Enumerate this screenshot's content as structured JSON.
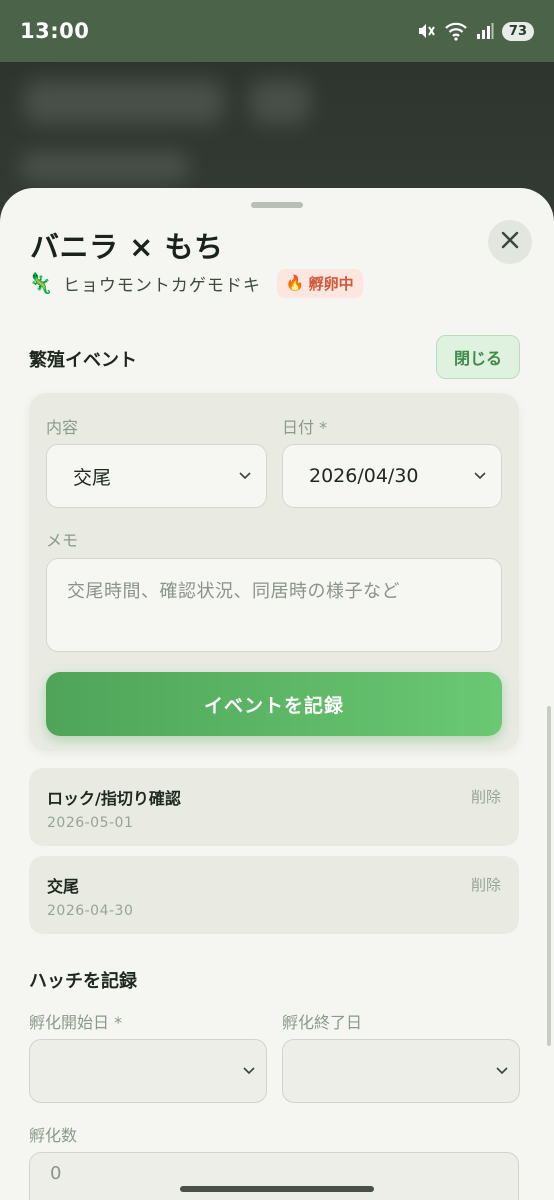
{
  "status_bar": {
    "time": "13:00",
    "battery": "73",
    "icons": [
      "mute-icon",
      "wifi-icon",
      "signal-icon"
    ]
  },
  "sheet": {
    "title": "バニラ × もち",
    "species_icon": "🦎",
    "species": "ヒョウモントカゲモドキ",
    "status_icon": "🔥",
    "status": "孵卵中",
    "close_icon": "close-icon"
  },
  "breeding_events": {
    "section_title": "繁殖イベント",
    "toggle_label": "閉じる",
    "form": {
      "content_label": "内容",
      "content_value": "交尾",
      "date_label": "日付 *",
      "date_value": "2026/04/30",
      "memo_label": "メモ",
      "memo_placeholder": "交尾時間、確認状況、同居時の様子など",
      "submit_label": "イベントを記録"
    },
    "events": [
      {
        "title": "ロック/指切り確認",
        "date": "2026-05-01",
        "delete_label": "削除"
      },
      {
        "title": "交尾",
        "date": "2026-04-30",
        "delete_label": "削除"
      }
    ]
  },
  "hatch": {
    "section_title": "ハッチを記録",
    "start_label": "孵化開始日 *",
    "end_label": "孵化終了日",
    "count_label": "孵化数",
    "count_value": "0"
  },
  "colors": {
    "accent": "#4fa459",
    "status_bar": "#4b6449",
    "sheet_bg": "#f5f6f1",
    "pill_bg": "#fbe7df",
    "pill_text": "#d2593a"
  }
}
